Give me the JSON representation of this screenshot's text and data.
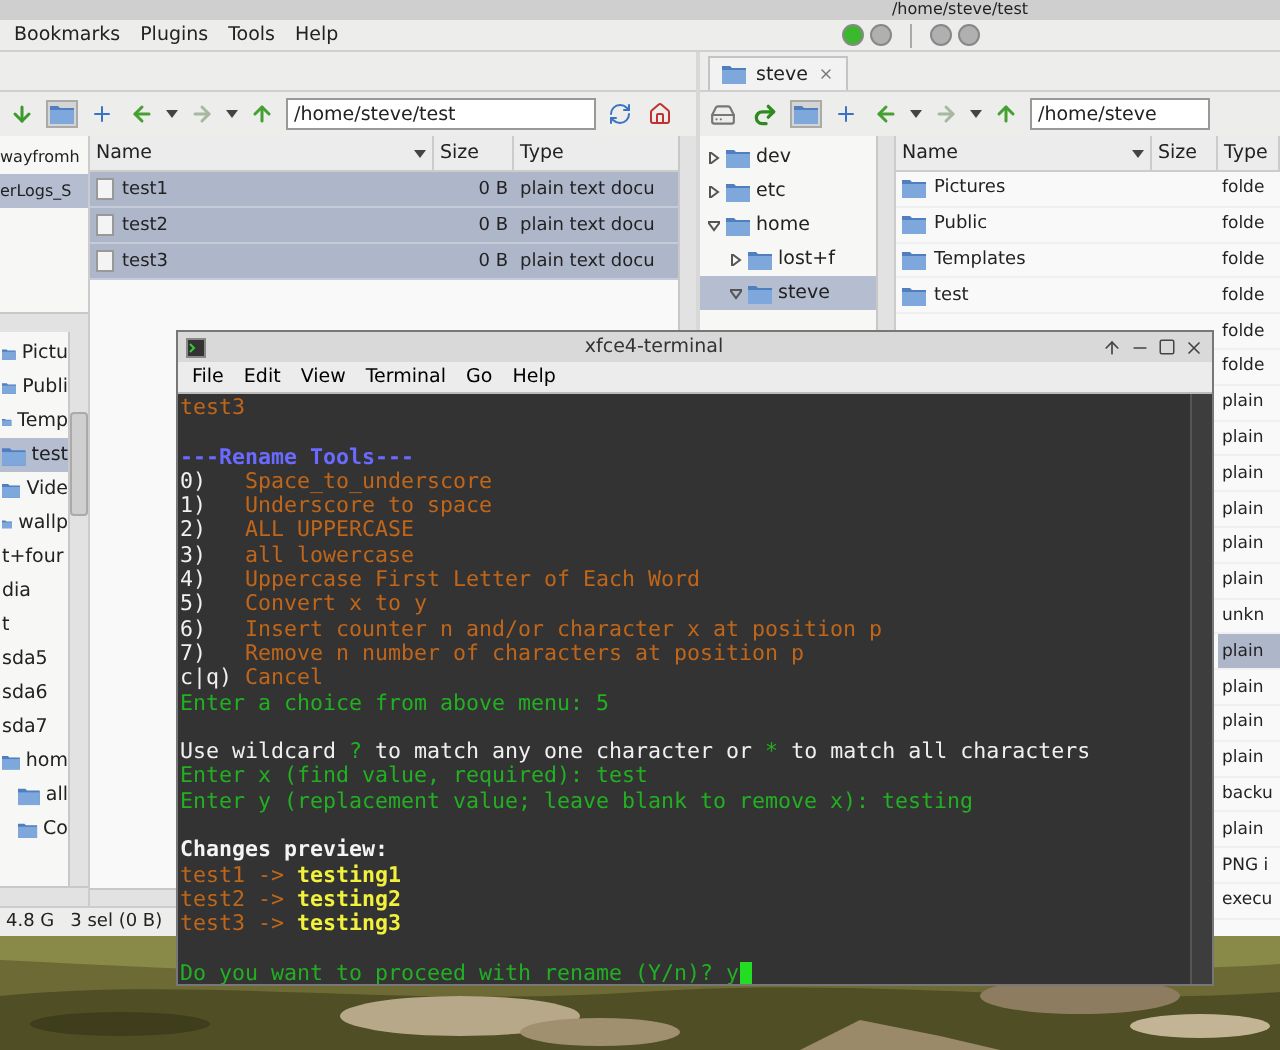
{
  "window": {
    "title": "/home/steve/test"
  },
  "menu": [
    "Bookmarks",
    "Plugins",
    "Tools",
    "Help"
  ],
  "toggles": [
    {
      "on": true
    },
    {
      "on": false
    },
    {
      "on": false
    },
    {
      "on": false
    }
  ],
  "left_pane": {
    "path": "/home/steve/test",
    "places": [
      {
        "label": "wayfromh",
        "selected": false
      },
      {
        "label": "erLogs_S",
        "selected": true
      }
    ],
    "tree": [
      {
        "label": "Pictu",
        "kind": "folder",
        "selected": false
      },
      {
        "label": "Publi",
        "kind": "folder",
        "selected": false
      },
      {
        "label": "Temp",
        "kind": "folder",
        "selected": false
      },
      {
        "label": "test",
        "kind": "folder",
        "selected": true
      },
      {
        "label": "Vide",
        "kind": "folder",
        "selected": false
      },
      {
        "label": "wallp",
        "kind": "folder",
        "selected": false
      },
      {
        "label": "t+four",
        "kind": "plain",
        "selected": false
      },
      {
        "label": "dia",
        "kind": "plain",
        "selected": false
      },
      {
        "label": "t",
        "kind": "plain",
        "selected": false
      },
      {
        "label": "sda5",
        "kind": "plain",
        "selected": false
      },
      {
        "label": "sda6",
        "kind": "plain",
        "selected": false
      },
      {
        "label": "sda7",
        "kind": "plain",
        "selected": false
      },
      {
        "label": "hom",
        "kind": "folder",
        "selected": false,
        "children": [
          {
            "label": "all",
            "kind": "folder",
            "selected": false
          },
          {
            "label": "Co",
            "kind": "folder",
            "selected": false
          }
        ]
      }
    ],
    "columns": [
      "Name",
      "Size",
      "Type"
    ],
    "rows": [
      {
        "name": "test1",
        "size": "0 B",
        "type": "plain text docu",
        "selected": true
      },
      {
        "name": "test2",
        "size": "0 B",
        "type": "plain text docu",
        "selected": true
      },
      {
        "name": "test3",
        "size": "0 B",
        "type": "plain text docu",
        "selected": true
      }
    ],
    "status": [
      "4.8 G",
      "3 sel (0 B)"
    ]
  },
  "right_pane": {
    "tab": "steve",
    "path": "/home/steve",
    "tree": [
      {
        "label": "dev",
        "expanded": false,
        "selected": false
      },
      {
        "label": "etc",
        "expanded": false,
        "selected": false
      },
      {
        "label": "home",
        "expanded": true,
        "selected": false,
        "children": [
          {
            "label": "lost+f",
            "expanded": false,
            "selected": false
          },
          {
            "label": "steve",
            "expanded": true,
            "selected": true
          }
        ]
      }
    ],
    "columns": [
      "Name",
      "Size",
      "Type"
    ],
    "rows": [
      {
        "name": "Pictures",
        "type": "folde",
        "selected": false
      },
      {
        "name": "Public",
        "type": "folde",
        "selected": false
      },
      {
        "name": "Templates",
        "type": "folde",
        "selected": false
      },
      {
        "name": "test",
        "type": "folde",
        "selected": false
      },
      {
        "type": "folde",
        "selected": false
      },
      {
        "type": "folde",
        "selected": false
      },
      {
        "type": "plain",
        "selected": false
      },
      {
        "type": "plain",
        "selected": false
      },
      {
        "type": "plain",
        "selected": false
      },
      {
        "type": "plain",
        "selected": false
      },
      {
        "type": "plain",
        "selected": false
      },
      {
        "type": "plain",
        "selected": false
      },
      {
        "type": "unkn",
        "selected": false
      },
      {
        "type": "plain",
        "selected": true
      },
      {
        "type": "plain",
        "selected": false
      },
      {
        "type": "plain",
        "selected": false
      },
      {
        "type": "plain",
        "selected": false
      },
      {
        "type": "backu",
        "selected": false
      },
      {
        "type": "plain",
        "selected": false
      },
      {
        "type": "PNG i",
        "selected": false
      },
      {
        "type": "execu",
        "selected": false
      }
    ]
  },
  "terminal": {
    "title": "xfce4-terminal",
    "menu": [
      "File",
      "Edit",
      "View",
      "Terminal",
      "Go",
      "Help"
    ],
    "cursor": true,
    "lines": [
      {
        "segments": [
          {
            "kind": "file",
            "text": "test3"
          }
        ]
      },
      {
        "space_before": true,
        "segments": [
          {
            "kind": "heading",
            "text": "---Rename Tools---"
          }
        ]
      },
      {
        "segments": [
          {
            "kind": "number",
            "text": "0)"
          },
          {
            "kind": "option",
            "text": "Space_to_underscore"
          }
        ]
      },
      {
        "segments": [
          {
            "kind": "number",
            "text": "1)"
          },
          {
            "kind": "option",
            "text": "Underscore to space"
          }
        ]
      },
      {
        "segments": [
          {
            "kind": "number",
            "text": "2)"
          },
          {
            "kind": "option",
            "text": "ALL UPPERCASE"
          }
        ]
      },
      {
        "segments": [
          {
            "kind": "number",
            "text": "3)"
          },
          {
            "kind": "option",
            "text": "all lowercase"
          }
        ]
      },
      {
        "segments": [
          {
            "kind": "number",
            "text": "4)"
          },
          {
            "kind": "option",
            "text": "Uppercase First Letter of Each Word"
          }
        ]
      },
      {
        "segments": [
          {
            "kind": "number",
            "text": "5)"
          },
          {
            "kind": "option",
            "text": "Convert x to y"
          }
        ]
      },
      {
        "segments": [
          {
            "kind": "number",
            "text": "6)"
          },
          {
            "kind": "option",
            "text": "Insert counter n and/or character x at position p"
          }
        ]
      },
      {
        "segments": [
          {
            "kind": "number",
            "text": "7)"
          },
          {
            "kind": "option",
            "text": "Remove n number of characters at position p"
          }
        ]
      },
      {
        "segments": [
          {
            "kind": "number",
            "text": "c|q)"
          },
          {
            "kind": "option",
            "text": "Cancel"
          }
        ]
      },
      {
        "segments": [
          {
            "kind": "prompt",
            "text": "Enter a choice from above menu: 5"
          }
        ]
      },
      {
        "space_before": true,
        "segments": [
          {
            "kind": "plain",
            "text": "Use wildcard "
          },
          {
            "kind": "wild",
            "text": "?"
          },
          {
            "kind": "plain",
            "text": " to match any one character or "
          },
          {
            "kind": "wild",
            "text": "*"
          },
          {
            "kind": "plain",
            "text": " to match all characters"
          }
        ]
      },
      {
        "segments": [
          {
            "kind": "prompt",
            "text": "Enter x (find value, required): test"
          }
        ]
      },
      {
        "segments": [
          {
            "kind": "prompt",
            "text": "Enter y (replacement value; leave blank to remove x): testing"
          }
        ]
      },
      {
        "space_before": true,
        "segments": [
          {
            "kind": "bold",
            "text": "Changes preview:"
          }
        ]
      },
      {
        "segments": [
          {
            "kind": "file",
            "text": "test1 -> "
          },
          {
            "kind": "result",
            "text": "testing1"
          }
        ]
      },
      {
        "segments": [
          {
            "kind": "file",
            "text": "test2 -> "
          },
          {
            "kind": "result",
            "text": "testing2"
          }
        ]
      },
      {
        "segments": [
          {
            "kind": "file",
            "text": "test3 -> "
          },
          {
            "kind": "result",
            "text": "testing3"
          }
        ]
      },
      {
        "space_before": true,
        "segments": [
          {
            "kind": "prompt",
            "text": "Do you want to proceed with rename (Y/n)? y"
          }
        ]
      }
    ]
  }
}
